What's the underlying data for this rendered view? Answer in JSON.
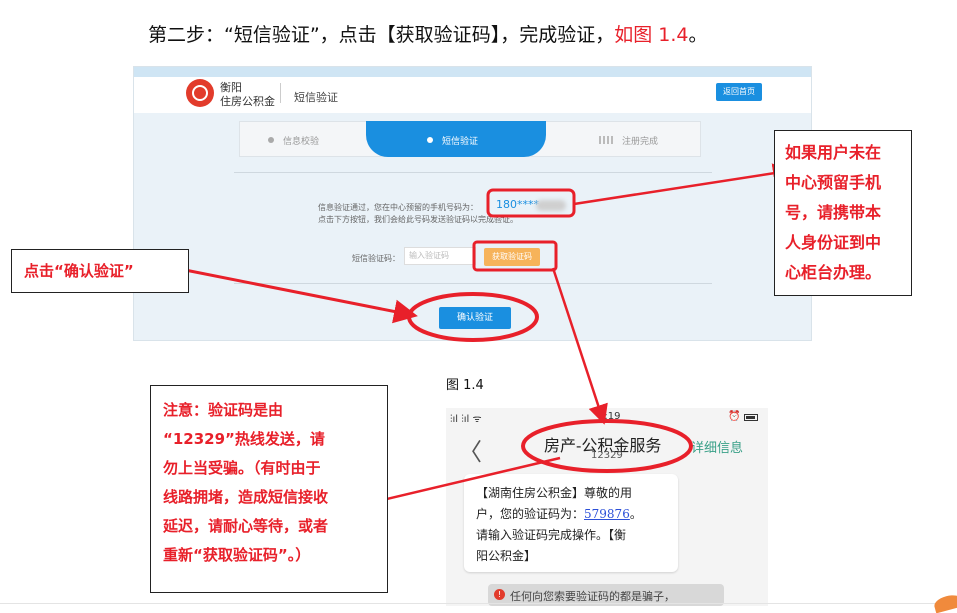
{
  "heading": {
    "text": "第二步：“短信验证”，点击【获取验证码】，完成验证，",
    "highlight": "如图 1.4",
    "end": "。"
  },
  "web": {
    "org_line1": "衡阳",
    "org_line2": "住房公积金",
    "header_title": "短信验证",
    "home_button": "返回首页",
    "steps": [
      "信息校验",
      "短信验证",
      "注册完成"
    ],
    "info_line1": "信息验证通过，您在中心预留的手机号码为：",
    "info_line2": "点击下方按钮，我们会给此号码发送验证码以完成验证。",
    "phone_masked": "180****",
    "code_label": "短信验证码：",
    "code_placeholder": "输入验证码",
    "get_code_button": "获取验证码",
    "confirm_button": "确认验证"
  },
  "figure_caption": "图 1.4",
  "phone": {
    "status_left": "⫶ıl ⫶ıl ᯤ",
    "status_time": "5:19",
    "alarm_icon": "⏰",
    "back_icon": "〈",
    "sender": "房产-公积金服务",
    "sender_number": "12329",
    "details_link": "详细信息",
    "sms_line1": "【湖南住房公积金】尊敬的用",
    "sms_line2_pre": "户，您的验证码为：",
    "sms_code": "579876",
    "sms_line2_post": "。",
    "sms_line3": "请输入验证码完成操作。【衡",
    "sms_line4": "阳公积金】",
    "warning_icon": "!",
    "warning_text": "任何向您索要验证码的都是骗子，"
  },
  "callouts": {
    "left": "点击“确认验证”",
    "right": [
      "如果用户未在",
      "中心预留手机",
      "号，请携带本",
      "人身份证到中",
      "心柜台办理。"
    ],
    "bottom": [
      "注意：验证码是由",
      "“12329”热线发送，请",
      "勿上当受骗。（有时由于",
      "线路拥堵，造成短信接收",
      "延迟，请耐心等待，或者",
      "重新“获取验证码”。）"
    ]
  },
  "colors": {
    "annotation_red": "#e8202a",
    "primary_blue": "#1a8fe0",
    "button_orange": "#f6b35a"
  }
}
